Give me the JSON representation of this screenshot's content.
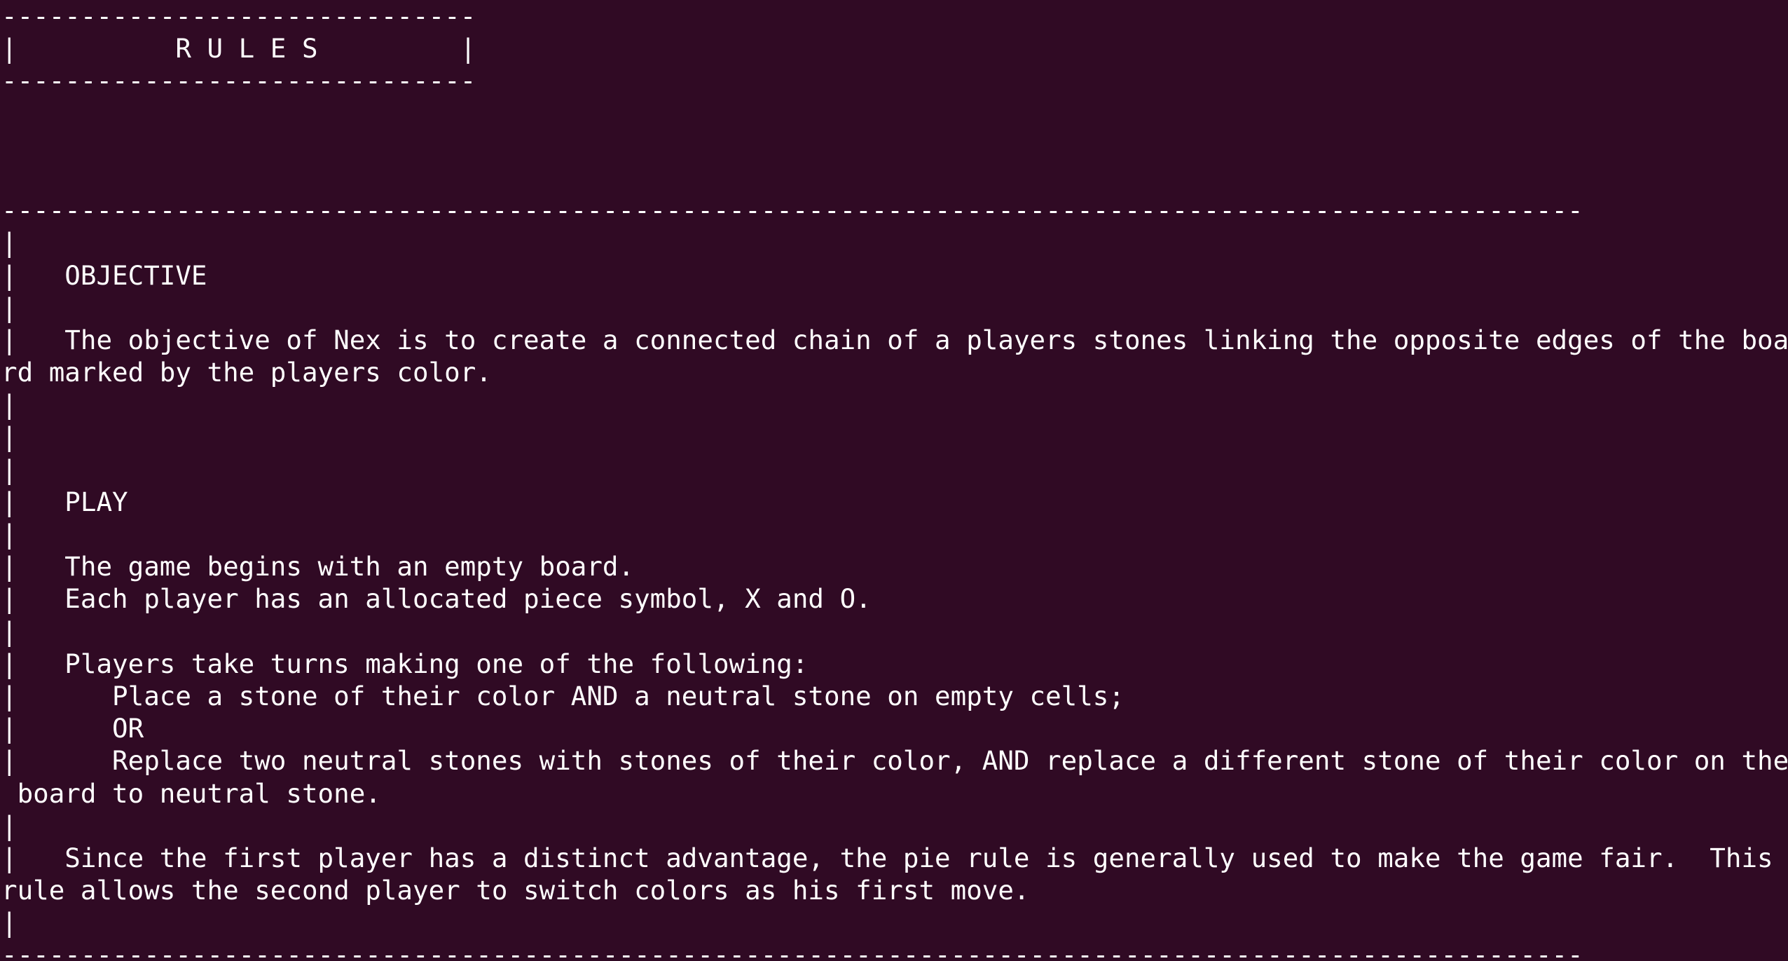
{
  "terminal": {
    "lines": [
      "------------------------------",
      "|          R U L E S         |",
      "------------------------------",
      "",
      "",
      "",
      "----------------------------------------------------------------------------------------------------",
      "|",
      "|   OBJECTIVE",
      "|",
      "|   The objective of Nex is to create a connected chain of a players stones linking the opposite edges of the boa",
      "rd marked by the players color.",
      "|",
      "|",
      "|",
      "|   PLAY",
      "|",
      "|   The game begins with an empty board.",
      "|   Each player has an allocated piece symbol, X and O.",
      "|",
      "|   Players take turns making one of the following:",
      "|      Place a stone of their color AND a neutral stone on empty cells;",
      "|      OR",
      "|      Replace two neutral stones with stones of their color, AND replace a different stone of their color on the",
      " board to neutral stone.",
      "|",
      "|   Since the first player has a distinct advantage, the pie rule is generally used to make the game fair.  This",
      "rule allows the second player to switch colors as his first move.",
      "|",
      "----------------------------------------------------------------------------------------------------"
    ]
  },
  "colors": {
    "background": "#300a24",
    "text": "#ffffff"
  }
}
